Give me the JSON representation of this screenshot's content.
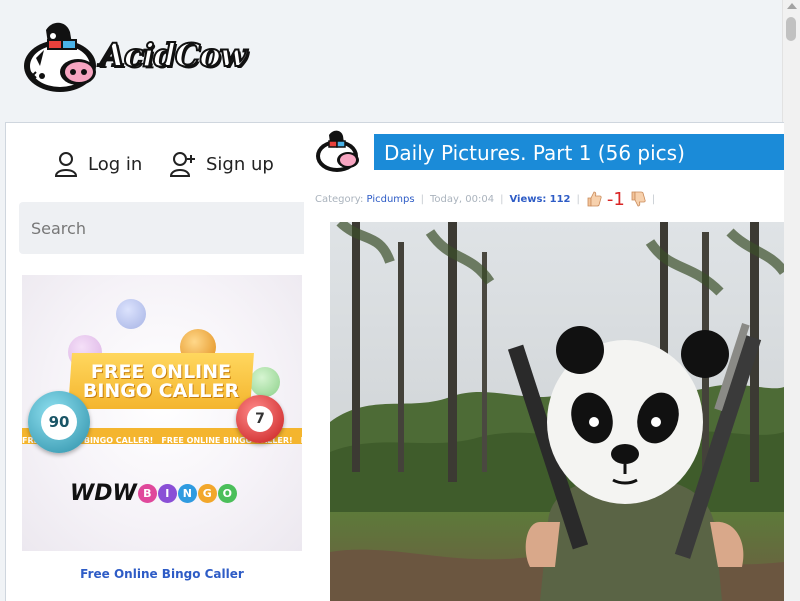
{
  "site": {
    "logo_text": "AcidCow"
  },
  "auth": {
    "login_label": "Log in",
    "signup_label": "Sign up"
  },
  "search": {
    "placeholder": "Search"
  },
  "ad": {
    "headline_line1": "FREE ONLINE",
    "headline_line2": "BINGO CALLER",
    "ribbon_text": "FREE ONLINE BINGO CALLER!",
    "ball_left_number": "90",
    "ball_right_number": "7",
    "brand_prefix": "WDW",
    "brand_balls": [
      "B",
      "I",
      "N",
      "G",
      "O"
    ],
    "caption": "Free Online Bingo Caller"
  },
  "article": {
    "title": "Daily Pictures. Part 1 (56 pics)",
    "category_label": "Category:",
    "category_value": "Picdumps",
    "date": "Today, 00:04",
    "views_label": "Views:",
    "views_value": "112",
    "rating": "-1"
  },
  "colors": {
    "title_bar": "#1b8bd8",
    "link": "#2e5cc6",
    "rating": "#d92525",
    "page_background": "#f0f3f6"
  },
  "icons": {
    "login": "user-icon",
    "signup": "user-plus-icon",
    "vote_up": "thumbs-up-icon",
    "vote_down": "thumbs-down-icon"
  }
}
